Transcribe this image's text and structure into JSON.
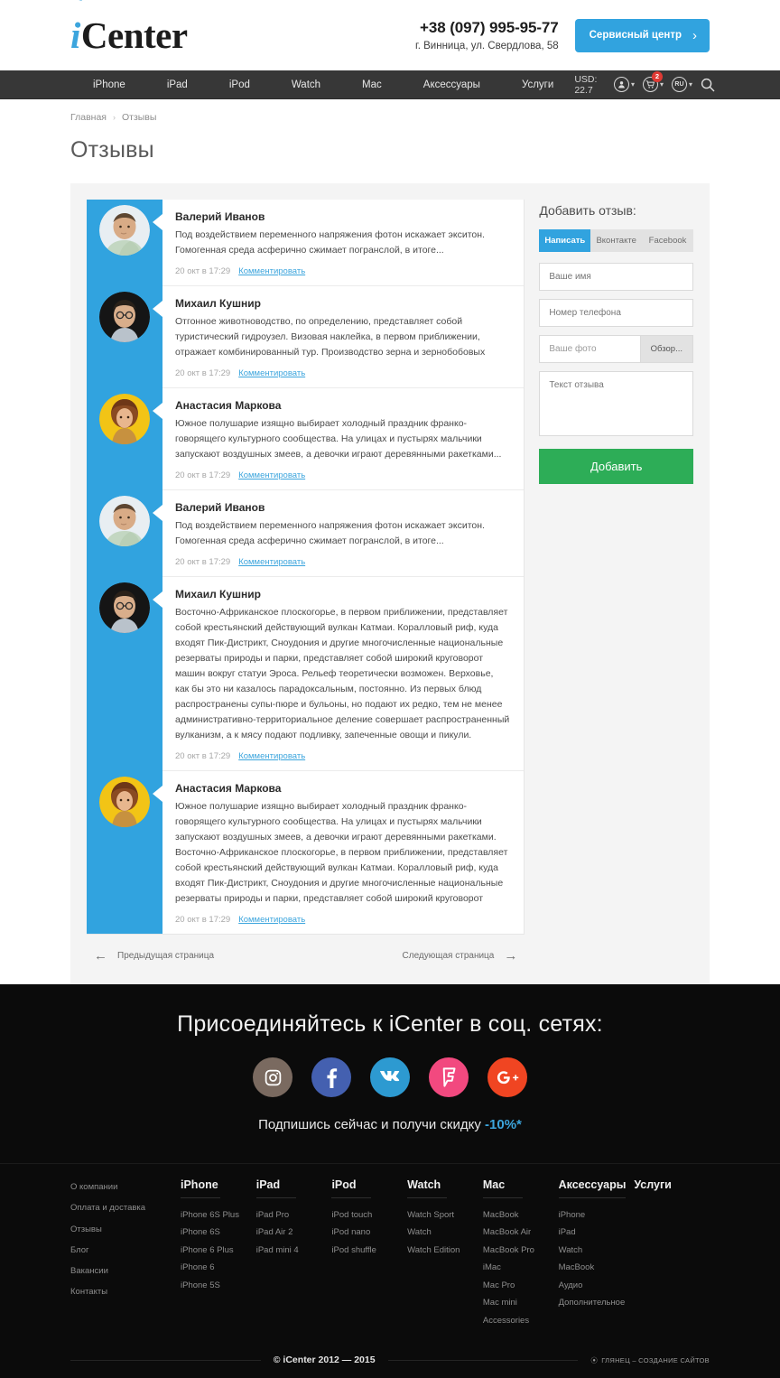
{
  "header": {
    "logo_i": "i",
    "logo_rest": "Center",
    "phone": "+38 (097) 995-95-77",
    "address": "г. Винница, ул. Свердлова, 58",
    "service_button": "Сервисный центр",
    "service_chevron": "›",
    "accent_blue": "#31a3df"
  },
  "nav": {
    "items": [
      {
        "label": "iPhone"
      },
      {
        "label": "iPad"
      },
      {
        "label": "iPod"
      },
      {
        "label": "Watch"
      },
      {
        "label": "Mac"
      },
      {
        "label": "Аксессуары"
      },
      {
        "label": "Услуги"
      }
    ],
    "currency": "USD: 22.7",
    "cart_badge": "2",
    "language": "RU",
    "icons": [
      "user-icon",
      "cart-icon",
      "language-icon",
      "search-icon"
    ]
  },
  "breadcrumb": {
    "home": "Главная",
    "separator": "›",
    "current": "Отзывы"
  },
  "page": {
    "title": "Отзывы"
  },
  "reviews": [
    {
      "name": "Валерий Иванов",
      "text": "Под воздействием переменного напряжения фотон искажает экситон. Гомогенная среда асферично сжимает погранслой, в итоге...",
      "date": "20 окт в 17:29",
      "comment_label": "Комментировать",
      "avatar": "man-blue-shirt"
    },
    {
      "name": "Михаил Кушнир",
      "text": "Отгонное животноводство, по определению, представляет собой туристический гидроузел. Визовая наклейка, в первом приближении, отражает комбинированный тур. Производство зерна и зернобобовых",
      "date": "20 окт в 17:29",
      "comment_label": "Комментировать",
      "avatar": "man-glasses"
    },
    {
      "name": "Анастасия Маркова",
      "text": "Южное полушарие изящно выбирает холодный праздник франко-говорящего культурного сообщества. На улицах и пустырях мальчики запускают воздушных змеев, а девочки играют деревянными ракетками...",
      "date": "20 окт в 17:29",
      "comment_label": "Комментировать",
      "avatar": "woman-yellow"
    },
    {
      "name": "Валерий Иванов",
      "text": "Под воздействием переменного напряжения фотон искажает экситон. Гомогенная среда асферично сжимает погранслой, в итоге...",
      "date": "20 окт в 17:29",
      "comment_label": "Комментировать",
      "avatar": "man-blue-shirt"
    },
    {
      "name": "Михаил Кушнир",
      "text": "Восточно-Африканское плоскогорье, в первом приближении, представляет собой крестьянский действующий вулкан Катмаи. Коралловый риф, куда входят Пик-Дистрикт, Сноудония и другие многочисленные национальные резерваты природы и парки, представляет собой широкий круговорот машин вокруг статуи Эроса. Рельеф теоретически возможен. Верховье, как бы это ни казалось парадоксальным, постоянно. Из первых блюд распространены супы-пюре и бульоны, но подают их редко, тем не менее административно-территориальное деление совершает распространенный вулканизм, а к мясу подают подливку, запеченные овощи и пикули.",
      "date": "20 окт в 17:29",
      "comment_label": "Комментировать",
      "avatar": "man-glasses"
    },
    {
      "name": "Анастасия Маркова",
      "text": "Южное полушарие изящно выбирает холодный праздник франко-говорящего культурного сообщества. На улицах и пустырях мальчики запускают воздушных змеев, а девочки играют деревянными ракетками. Восточно-Африканское плоскогорье, в первом приближении, представляет собой крестьянский действующий вулкан Катмаи. Коралловый риф, куда входят Пик-Дистрикт, Сноудония и другие многочисленные национальные резерваты природы и парки, представляет собой широкий круговорот",
      "date": "20 окт в 17:29",
      "comment_label": "Комментировать",
      "avatar": "woman-yellow"
    }
  ],
  "form": {
    "title": "Добавить отзыв:",
    "tabs": [
      {
        "label": "Написать",
        "active": true
      },
      {
        "label": "Вконтакте",
        "active": false
      },
      {
        "label": "Facebook",
        "active": false
      }
    ],
    "name_placeholder": "Ваше имя",
    "phone_placeholder": "Номер телефона",
    "photo_label": "Ваше фото",
    "browse_label": "Обзор...",
    "text_placeholder": "Текст отзыва",
    "submit_label": "Добавить",
    "submit_color": "#2dad57"
  },
  "pagination": {
    "prev": "Предыдущая страница",
    "next": "Следующая страница",
    "prev_arrow": "←",
    "next_arrow": "→"
  },
  "social": {
    "heading": "Присоединяйтесь к iCenter в соц. сетях:",
    "subtext": "Подпишись сейчас и получи скидку",
    "discount": "-10%*",
    "networks": [
      {
        "name": "instagram",
        "color": "#7a6a60"
      },
      {
        "name": "facebook",
        "color": "#4460b0"
      },
      {
        "name": "vk",
        "color": "#2d9ad1"
      },
      {
        "name": "foursquare",
        "color": "#f2497f"
      },
      {
        "name": "google-plus",
        "color": "#f04522"
      }
    ]
  },
  "footer": {
    "columns": [
      {
        "title": "",
        "links": [
          "О компании",
          "Оплата и доставка",
          "Отзывы",
          "Блог",
          "Вакансии",
          "Контакты"
        ]
      },
      {
        "title": "iPhone",
        "links": [
          "iPhone 6S Plus",
          "iPhone 6S",
          "iPhone 6 Plus",
          "iPhone 6",
          "iPhone 5S"
        ]
      },
      {
        "title": "iPad",
        "links": [
          "iPad Pro",
          "iPad Air 2",
          "iPad mini 4"
        ]
      },
      {
        "title": "iPod",
        "links": [
          "iPod touch",
          "iPod nano",
          "iPod shuffle"
        ]
      },
      {
        "title": "Watch",
        "links": [
          "Watch Sport",
          "Watch",
          "Watch Edition"
        ]
      },
      {
        "title": "Mac",
        "links": [
          "MacBook",
          "MacBook Air",
          "MacBook Pro",
          "iMac",
          "Mac Pro",
          "Mac mini",
          "Accessories"
        ]
      },
      {
        "title": "Аксессуары",
        "links": [
          "iPhone",
          "iPad",
          "Watch",
          "MacBook",
          "Аудио",
          "Дополнительное"
        ]
      },
      {
        "title": "Услуги",
        "links": []
      }
    ],
    "copyright": "© iCenter  2012 — 2015",
    "made_by": "ГЛЯНЕЦ – СОЗДАНИЕ САЙТОВ"
  }
}
